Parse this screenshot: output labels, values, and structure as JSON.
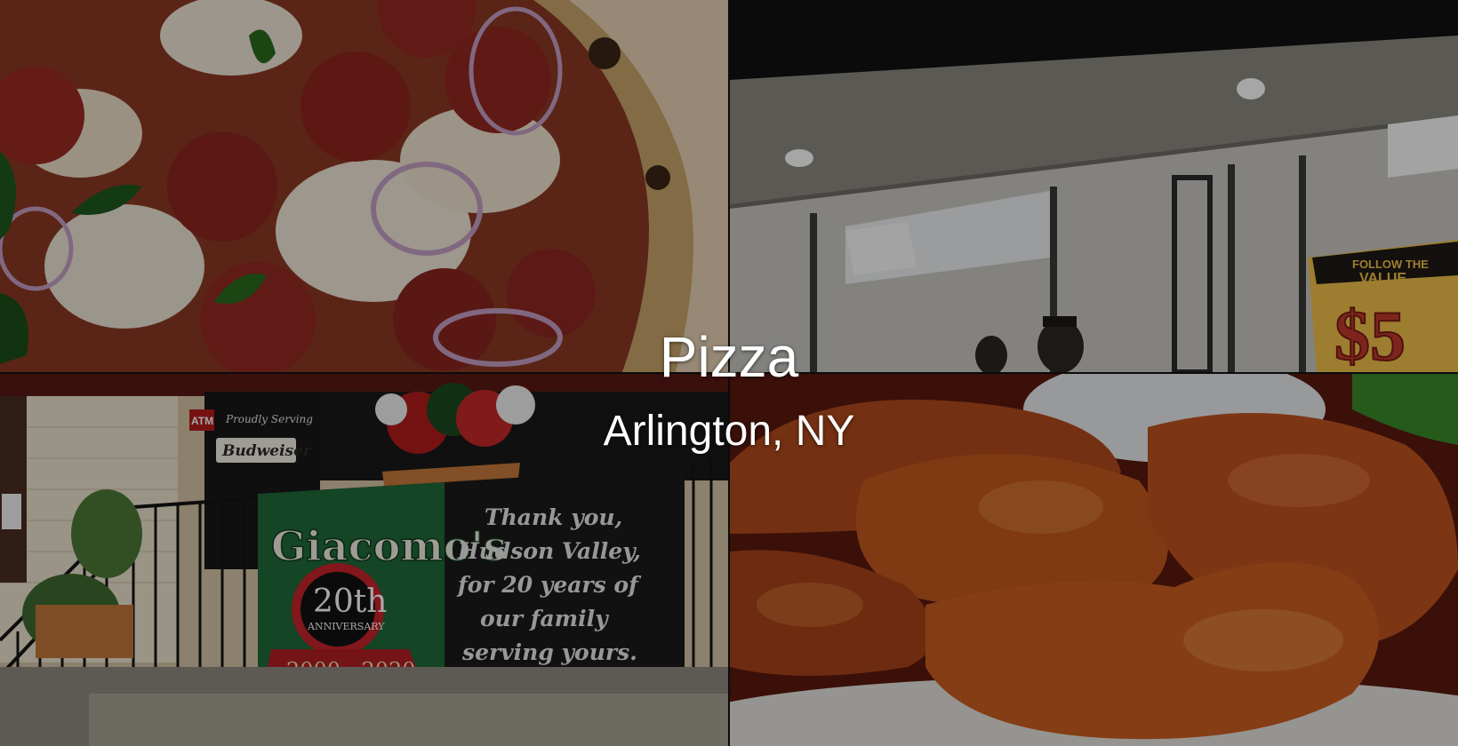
{
  "hero": {
    "title": "Pizza",
    "location": "Arlington, NY"
  },
  "photos": [
    {
      "subject": "pepperoni pizza with red onion"
    },
    {
      "subject": "pizzeria storefront",
      "sign_text": [
        "FOLLOW THE",
        "VALUE",
        "$5"
      ]
    },
    {
      "subject": "Giacomo's anniversary banner",
      "banner_brand": "Giacomo's",
      "anniversary": "20th",
      "anniversary_word": "ANNIVERSARY",
      "years": "2000 - 2020",
      "message": [
        "Thank you,",
        "Hudson Valley,",
        "for 20 years of",
        "our family",
        "serving yours."
      ],
      "window_text": [
        "Proudly Serving",
        "Budweiser",
        "ATM"
      ]
    },
    {
      "subject": "glazed chicken wings"
    }
  ],
  "colors": {
    "overlay": "#00000059",
    "text": "#ffffff",
    "banner_green": "#1f6b3a",
    "banner_red": "#c8242b"
  }
}
